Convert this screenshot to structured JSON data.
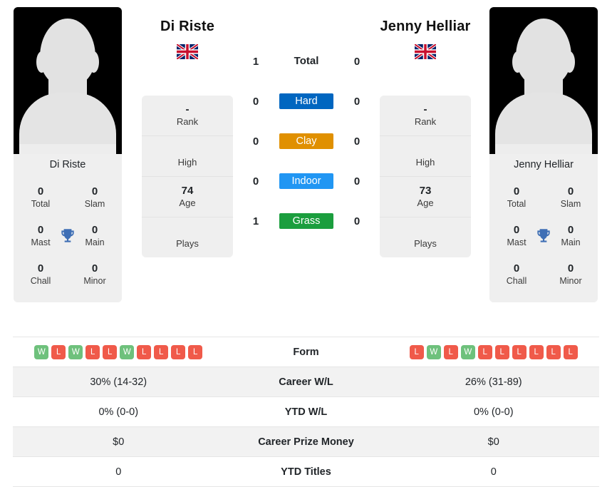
{
  "players": {
    "left": {
      "name": "Di Riste",
      "card_name": "Di Riste",
      "flag": "uk-flag-icon",
      "titles": {
        "total_value": "0",
        "total_label": "Total",
        "slam_value": "0",
        "slam_label": "Slam",
        "mast_value": "0",
        "mast_label": "Mast",
        "main_value": "0",
        "main_label": "Main",
        "chall_value": "0",
        "chall_label": "Chall",
        "minor_value": "0",
        "minor_label": "Minor"
      },
      "info": {
        "rank_value": "-",
        "rank_label": "Rank",
        "high_value": "",
        "high_label": "High",
        "age_value": "74",
        "age_label": "Age",
        "plays_value": "",
        "plays_label": "Plays"
      },
      "form": [
        "W",
        "L",
        "W",
        "L",
        "L",
        "W",
        "L",
        "L",
        "L",
        "L"
      ],
      "career_wl": "30% (14-32)",
      "ytd_wl": "0% (0-0)",
      "career_prize_money": "$0",
      "ytd_titles": "0"
    },
    "right": {
      "name": "Jenny Helliar",
      "card_name": "Jenny Helliar",
      "flag": "uk-flag-icon",
      "titles": {
        "total_value": "0",
        "total_label": "Total",
        "slam_value": "0",
        "slam_label": "Slam",
        "mast_value": "0",
        "mast_label": "Mast",
        "main_value": "0",
        "main_label": "Main",
        "chall_value": "0",
        "chall_label": "Chall",
        "minor_value": "0",
        "minor_label": "Minor"
      },
      "info": {
        "rank_value": "-",
        "rank_label": "Rank",
        "high_value": "",
        "high_label": "High",
        "age_value": "73",
        "age_label": "Age",
        "plays_value": "",
        "plays_label": "Plays"
      },
      "form": [
        "L",
        "W",
        "L",
        "W",
        "L",
        "L",
        "L",
        "L",
        "L",
        "L"
      ],
      "career_wl": "26% (31-89)",
      "ytd_wl": "0% (0-0)",
      "career_prize_money": "$0",
      "ytd_titles": "0"
    }
  },
  "h2h": {
    "total": {
      "label": "Total",
      "left": "1",
      "right": "0"
    },
    "surfaces": [
      {
        "label": "Hard",
        "left": "0",
        "right": "0",
        "color": "#0066c0"
      },
      {
        "label": "Clay",
        "left": "0",
        "right": "0",
        "color": "#e09000"
      },
      {
        "label": "Indoor",
        "left": "0",
        "right": "0",
        "color": "#2196f3"
      },
      {
        "label": "Grass",
        "left": "1",
        "right": "0",
        "color": "#1b9e3e"
      }
    ]
  },
  "comparison_rows": [
    {
      "label": "Form",
      "left": "",
      "right": ""
    },
    {
      "label": "Career W/L",
      "left": "30% (14-32)",
      "right": "26% (31-89)"
    },
    {
      "label": "YTD W/L",
      "left": "0% (0-0)",
      "right": "0% (0-0)"
    },
    {
      "label": "Career Prize Money",
      "left": "$0",
      "right": "$0"
    },
    {
      "label": "YTD Titles",
      "left": "0",
      "right": "0"
    }
  ],
  "colors": {
    "win_badge": "#6ec17c",
    "loss_badge": "#f05a4a",
    "trophy": "#3f6fb5",
    "card_bg": "#efefef",
    "row_alt_bg": "#f2f2f2"
  }
}
